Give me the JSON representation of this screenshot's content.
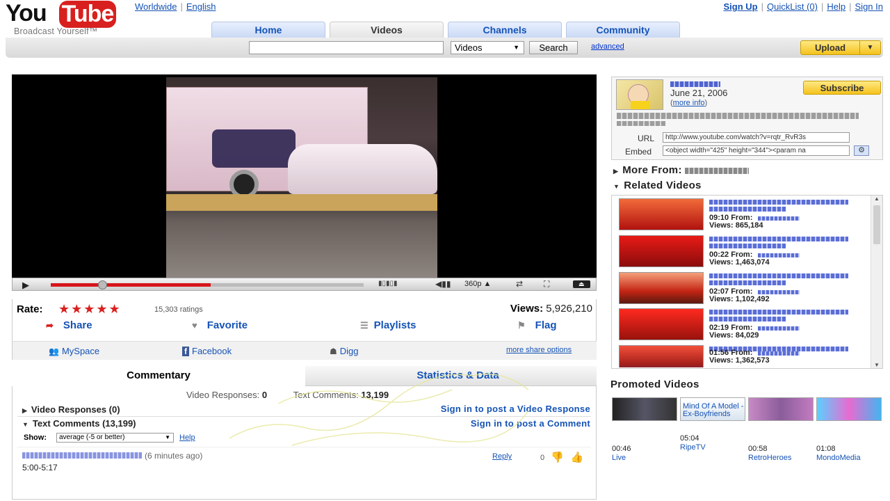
{
  "brand": {
    "you": "You",
    "tube": "Tube",
    "tagline": "Broadcast Yourself™"
  },
  "locale": {
    "region": "Worldwide",
    "language": "English"
  },
  "user_links": {
    "signup": "Sign Up",
    "quicklist": "QuickList (0)",
    "help": "Help",
    "signin": "Sign In"
  },
  "tabs": [
    {
      "label": "Home"
    },
    {
      "label": "Videos"
    },
    {
      "label": "Channels"
    },
    {
      "label": "Community"
    }
  ],
  "search": {
    "value": "",
    "category": "Videos",
    "button": "Search",
    "advanced": "advanced"
  },
  "upload": {
    "label": "Upload"
  },
  "player": {
    "quality": "360p",
    "progress_fraction": 0.15,
    "buffered_fraction": 0.51
  },
  "rating": {
    "label": "Rate:",
    "stars": "★★★★★",
    "count": "15,303 ratings",
    "views_label": "Views:",
    "views_value": "5,926,210"
  },
  "actions": {
    "share": "Share",
    "favorite": "Favorite",
    "playlists": "Playlists",
    "flag": "Flag"
  },
  "social": {
    "myspace": "MySpace",
    "facebook": "Facebook",
    "digg": "Digg",
    "more": "more share options"
  },
  "panel_tabs": {
    "commentary": "Commentary",
    "stats": "Statistics & Data"
  },
  "counts": {
    "vr_label": "Video Responses:",
    "vr_value": "0",
    "tc_label": "Text Comments:",
    "tc_value": "13,199"
  },
  "sections": {
    "video_responses": "Video Responses (0)",
    "text_comments": "Text Comments (13,199)",
    "sign_in_vr": "Sign in to post a Video Response",
    "sign_in_comment": "Sign in to post a Comment"
  },
  "filter": {
    "label": "Show:",
    "value": "average (-5 or better)",
    "help": "Help"
  },
  "comment": {
    "time": "(6 minutes ago)",
    "text": "5:00-5:17",
    "reply": "Reply",
    "score": "0"
  },
  "channel": {
    "date": "June 21, 2006",
    "more_info_pre": "(",
    "more_info": "more info",
    "more_info_post": ")",
    "subscribe": "Subscribe"
  },
  "share_fields": {
    "url_label": "URL",
    "url_value": "http://www.youtube.com/watch?v=rqtr_RvR3s",
    "embed_label": "Embed",
    "embed_value": "<object width=\"425\" height=\"344\"><param na"
  },
  "more_from": {
    "label": "More From:"
  },
  "related": {
    "title": "Related Videos",
    "items": [
      {
        "duration": "09:10 From:",
        "views": "Views: 865,184"
      },
      {
        "duration": "00:22 From:",
        "views": "Views: 1,463,074"
      },
      {
        "duration": "02:07 From:",
        "views": "Views: 1,102,492"
      },
      {
        "duration": "02:19 From:",
        "views": "Views: 84,029"
      },
      {
        "duration": "01:56 From:",
        "views": "Views: 1,362,573"
      }
    ]
  },
  "promoted": {
    "title": "Promoted Videos",
    "items": [
      {
        "title": "",
        "duration": "00:46",
        "channel": "Live"
      },
      {
        "title": "Mind Of A Model - Ex-Boyfriends",
        "duration": "05:04",
        "channel": "RipeTV"
      },
      {
        "title": "",
        "duration": "00:58",
        "channel": "RetroHeroes"
      },
      {
        "title": "",
        "duration": "01:08",
        "channel": "MondoMedia"
      }
    ]
  },
  "colors": {
    "brand_red": "#d8201e",
    "link_blue": "#1553b5",
    "upload_yellow": "#f4c21c"
  }
}
